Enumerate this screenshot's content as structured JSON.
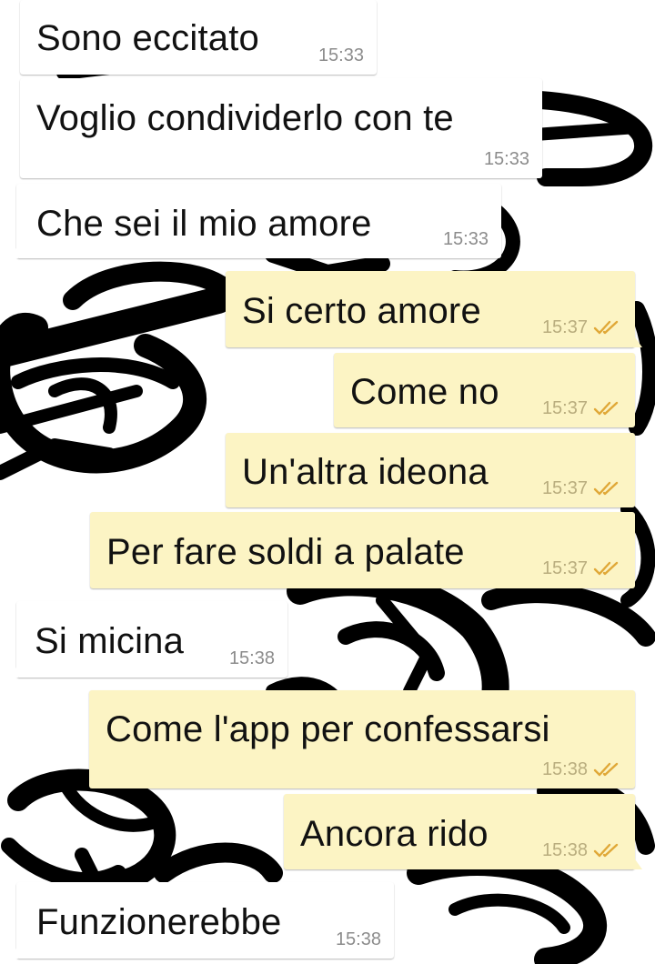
{
  "messages": [
    {
      "text": "Sono eccitato",
      "time": "15:33",
      "direction": "incoming"
    },
    {
      "text": "Voglio condividerlo con te",
      "time": "15:33",
      "direction": "incoming"
    },
    {
      "text": "Che sei il mio amore",
      "time": "15:33",
      "direction": "incoming"
    },
    {
      "text": "Si certo amore",
      "time": "15:37",
      "direction": "outgoing",
      "status": "read-ticks-icon"
    },
    {
      "text": "Come no",
      "time": "15:37",
      "direction": "outgoing",
      "status": "read-ticks-icon"
    },
    {
      "text": "Un'altra ideona",
      "time": "15:37",
      "direction": "outgoing",
      "status": "read-ticks-icon"
    },
    {
      "text": "Per fare soldi a palate",
      "time": "15:37",
      "direction": "outgoing",
      "status": "read-ticks-icon"
    },
    {
      "text": "Si micina",
      "time": "15:38",
      "direction": "incoming"
    },
    {
      "text": "Come l'app per confessarsi",
      "time": "15:38",
      "direction": "outgoing",
      "status": "read-ticks-icon"
    },
    {
      "text": "Ancora rido",
      "time": "15:38",
      "direction": "outgoing",
      "status": "read-ticks-icon"
    },
    {
      "text": "Funzionerebbe",
      "time": "15:38",
      "direction": "incoming"
    }
  ],
  "colors": {
    "incoming_bubble": "#ffffff",
    "outgoing_bubble": "#fcf4c4",
    "read_ticks": "#e0a838",
    "wallpaper_ink": "#000000"
  },
  "wallpaper": "chain-links-pattern"
}
